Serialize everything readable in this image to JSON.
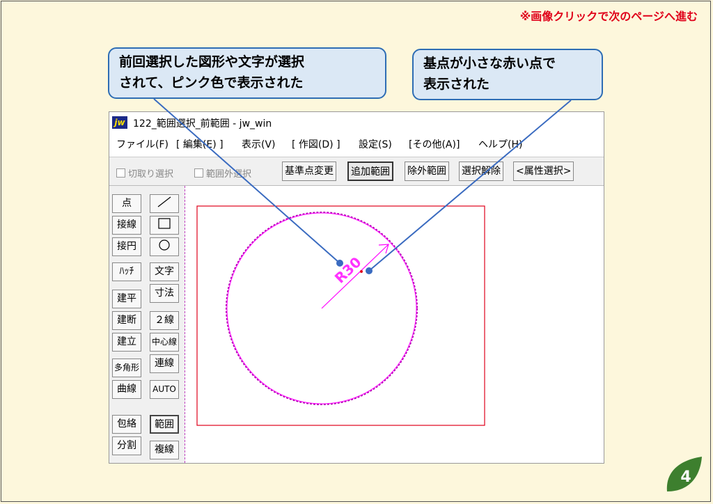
{
  "top_note": "※画像クリックで次のページへ進む",
  "callouts": {
    "left_line1": "前回選択した図形や文字が選択",
    "left_line2": "されて、ピンク色で表示された",
    "right_line1": "基点が小さな赤い点で",
    "right_line2": "表示された"
  },
  "window": {
    "app_icon_text": "jw",
    "title": "122_範囲選択_前範囲 - jw_win",
    "menu": [
      "ファイル(F)",
      "[ 編集(E) ]",
      "表示(V)",
      "[ 作図(D) ]",
      "設定(S)",
      "[その他(A)]",
      "ヘルプ(H)"
    ],
    "toolbar": {
      "check1": "切取り選択",
      "check2": "範囲外選択",
      "buttons": [
        "基準点変更",
        "追加範囲",
        "除外範囲",
        "選択解除",
        "<属性選択>"
      ]
    },
    "left_col1": [
      "点",
      "接線",
      "接円",
      "ﾊｯﾁ",
      "建平",
      "建断",
      "建立",
      "多角形",
      "曲線",
      "包絡",
      "分割"
    ],
    "left_col2_icons": [
      "line-icon",
      "rectangle-icon",
      "circle-icon"
    ],
    "left_col2": [
      "文字",
      "寸法",
      "２線",
      "中心線",
      "連線",
      "AUTO",
      "範囲",
      "複線"
    ],
    "drawing": {
      "dimension_label": "R30"
    }
  },
  "page_number": "4",
  "colors": {
    "background": "#fdf7dc",
    "callout_fill": "#dbe8f5",
    "callout_border": "#2e6db4",
    "selected": "#ff00ff",
    "frame_red": "#e0001a",
    "badge_green": "#3d7f2e"
  }
}
